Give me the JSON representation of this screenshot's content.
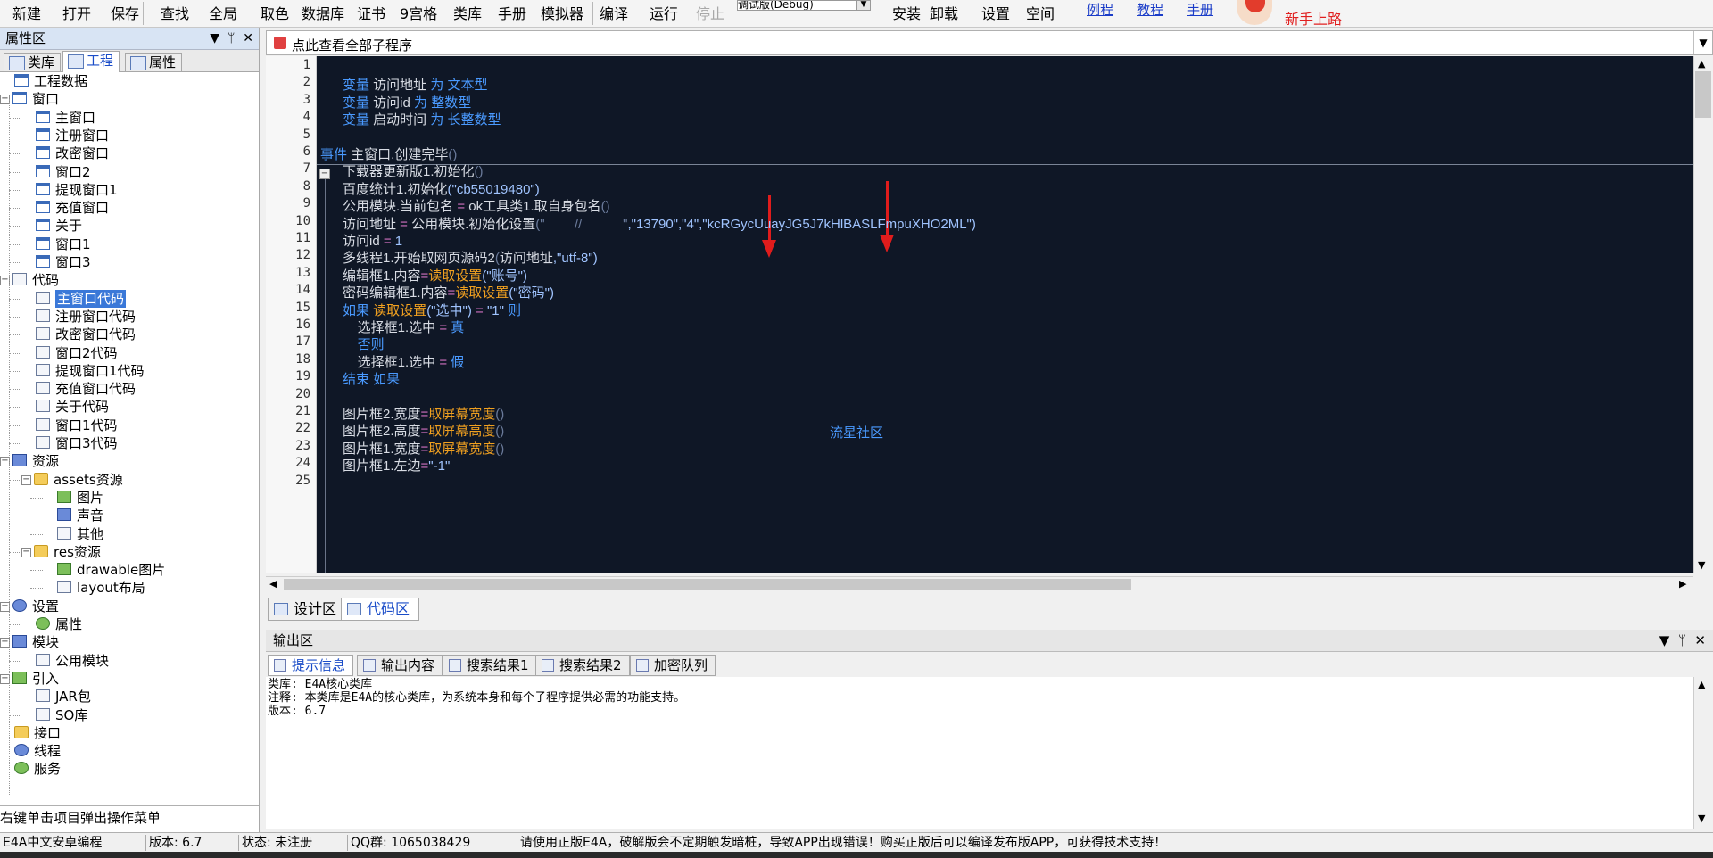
{
  "toolbar": {
    "items": [
      {
        "label": "新建",
        "icon": "new-icon"
      },
      {
        "label": "打开",
        "icon": "open-icon"
      },
      {
        "label": "保存",
        "icon": "save-icon"
      },
      {
        "label": "查找",
        "icon": "find-icon"
      },
      {
        "label": "全局",
        "icon": "global-icon"
      },
      {
        "label": "取色",
        "icon": "color-picker-icon"
      },
      {
        "label": "数据库",
        "icon": "database-icon"
      },
      {
        "label": "证书",
        "icon": "certificate-icon"
      },
      {
        "label": "9宫格",
        "icon": "grid-icon"
      },
      {
        "label": "类库",
        "icon": "library-icon"
      },
      {
        "label": "手册",
        "icon": "manual-icon"
      },
      {
        "label": "模拟器",
        "icon": "emulator-icon"
      },
      {
        "label": "编译",
        "icon": "compile-icon"
      },
      {
        "label": "运行",
        "icon": "run-icon"
      },
      {
        "label": "停止",
        "icon": "stop-icon"
      },
      {
        "label": "安装",
        "icon": "install-icon"
      },
      {
        "label": "卸载",
        "icon": "uninstall-icon"
      },
      {
        "label": "设置",
        "icon": "settings-icon"
      },
      {
        "label": "空间",
        "icon": "space-icon"
      }
    ],
    "mode": "调试版(Debug)",
    "links": [
      "例程",
      "教程",
      "手册"
    ],
    "newbie": "新手上路"
  },
  "left": {
    "title": "属性区",
    "tabs": [
      "类库",
      "工程",
      "属性"
    ],
    "hint": "右键单击项目弹出操作菜单",
    "tree": [
      {
        "label": "工程数据",
        "depth": 0,
        "icon": "project-icon",
        "exp": ""
      },
      {
        "label": "窗口",
        "depth": 0,
        "icon": "window-folder-icon",
        "exp": "-"
      },
      {
        "label": "主窗口",
        "depth": 1,
        "icon": "window-icon",
        "exp": ""
      },
      {
        "label": "注册窗口",
        "depth": 1,
        "icon": "window-icon",
        "exp": ""
      },
      {
        "label": "改密窗口",
        "depth": 1,
        "icon": "window-icon",
        "exp": ""
      },
      {
        "label": "窗口2",
        "depth": 1,
        "icon": "window-icon",
        "exp": ""
      },
      {
        "label": "提现窗口1",
        "depth": 1,
        "icon": "window-icon",
        "exp": ""
      },
      {
        "label": "充值窗口",
        "depth": 1,
        "icon": "window-icon",
        "exp": ""
      },
      {
        "label": "关于",
        "depth": 1,
        "icon": "window-icon",
        "exp": ""
      },
      {
        "label": "窗口1",
        "depth": 1,
        "icon": "window-icon",
        "exp": ""
      },
      {
        "label": "窗口3",
        "depth": 1,
        "icon": "window-icon",
        "exp": ""
      },
      {
        "label": "代码",
        "depth": 0,
        "icon": "code-folder-icon",
        "exp": "-"
      },
      {
        "label": "主窗口代码",
        "depth": 1,
        "icon": "code-file-icon",
        "exp": "",
        "selected": true
      },
      {
        "label": "注册窗口代码",
        "depth": 1,
        "icon": "code-file-icon",
        "exp": ""
      },
      {
        "label": "改密窗口代码",
        "depth": 1,
        "icon": "code-file-icon",
        "exp": ""
      },
      {
        "label": "窗口2代码",
        "depth": 1,
        "icon": "code-file-icon",
        "exp": ""
      },
      {
        "label": "提现窗口1代码",
        "depth": 1,
        "icon": "code-file-icon",
        "exp": ""
      },
      {
        "label": "充值窗口代码",
        "depth": 1,
        "icon": "code-file-icon",
        "exp": ""
      },
      {
        "label": "关于代码",
        "depth": 1,
        "icon": "code-file-icon",
        "exp": ""
      },
      {
        "label": "窗口1代码",
        "depth": 1,
        "icon": "code-file-icon",
        "exp": ""
      },
      {
        "label": "窗口3代码",
        "depth": 1,
        "icon": "code-file-icon",
        "exp": ""
      },
      {
        "label": "资源",
        "depth": 0,
        "icon": "resource-icon",
        "exp": "-"
      },
      {
        "label": "assets资源",
        "depth": 1,
        "icon": "folder-icon",
        "exp": "-"
      },
      {
        "label": "图片",
        "depth": 2,
        "icon": "image-icon",
        "exp": ""
      },
      {
        "label": "声音",
        "depth": 2,
        "icon": "music-icon",
        "exp": ""
      },
      {
        "label": "其他",
        "depth": 2,
        "icon": "question-icon",
        "exp": ""
      },
      {
        "label": "res资源",
        "depth": 1,
        "icon": "folder-icon",
        "exp": "-"
      },
      {
        "label": "drawable图片",
        "depth": 2,
        "icon": "image-icon",
        "exp": ""
      },
      {
        "label": "layout布局",
        "depth": 2,
        "icon": "layout-icon",
        "exp": ""
      },
      {
        "label": "设置",
        "depth": 0,
        "icon": "info-icon",
        "exp": "-"
      },
      {
        "label": "属性",
        "depth": 1,
        "icon": "gear-icon",
        "exp": ""
      },
      {
        "label": "模块",
        "depth": 0,
        "icon": "module-icon",
        "exp": "-"
      },
      {
        "label": "公用模块",
        "depth": 1,
        "icon": "module-file-icon",
        "exp": ""
      },
      {
        "label": "引入",
        "depth": 0,
        "icon": "import-icon",
        "exp": "-"
      },
      {
        "label": "JAR包",
        "depth": 1,
        "icon": "jar-icon",
        "exp": ""
      },
      {
        "label": "SO库",
        "depth": 1,
        "icon": "so-icon",
        "exp": ""
      },
      {
        "label": "接口",
        "depth": 0,
        "icon": "interface-icon",
        "exp": ""
      },
      {
        "label": "线程",
        "depth": 0,
        "icon": "thread-icon",
        "exp": ""
      },
      {
        "label": "服务",
        "depth": 0,
        "icon": "service-icon",
        "exp": ""
      }
    ]
  },
  "editor": {
    "subroutine_bar": "点此查看全部子程序",
    "lines": [
      {
        "n": "1",
        "segs": []
      },
      {
        "n": "2",
        "segs": [
          [
            "kw",
            "变量 "
          ],
          [
            "",
            "访问地址 "
          ],
          [
            "kw",
            "为 "
          ],
          [
            "tp",
            "文本型"
          ]
        ]
      },
      {
        "n": "3",
        "segs": [
          [
            "kw",
            "变量 "
          ],
          [
            "",
            "访问id "
          ],
          [
            "kw",
            "为 "
          ],
          [
            "tp",
            "整数型"
          ]
        ]
      },
      {
        "n": "4",
        "segs": [
          [
            "kw",
            "变量 "
          ],
          [
            "",
            "启动时间 "
          ],
          [
            "kw",
            "为 "
          ],
          [
            "tp",
            "长整数型"
          ]
        ]
      },
      {
        "n": "5",
        "segs": []
      },
      {
        "n": "6",
        "segs": [
          [
            "kw",
            "事件 "
          ],
          [
            "",
            "主窗口.创建完毕"
          ],
          [
            "dim",
            "()"
          ]
        ]
      },
      {
        "n": "7",
        "segs": [
          [
            "",
            "下载器更新版1.初始化"
          ],
          [
            "dim",
            "()"
          ]
        ]
      },
      {
        "n": "8",
        "segs": [
          [
            "",
            "百度统计1.初始化"
          ],
          [
            "st",
            "(\"cb55019480\")"
          ]
        ]
      },
      {
        "n": "9",
        "segs": [
          [
            "",
            "公用模块.当前包名 "
          ],
          [
            "op",
            "= "
          ],
          [
            "",
            "ok工具类1.取自身包名"
          ],
          [
            "dim",
            "()"
          ]
        ]
      },
      {
        "n": "10",
        "segs": [
          [
            "",
            "访问地址 "
          ],
          [
            "op",
            "= "
          ],
          [
            "",
            "公用模块.初始化设置"
          ],
          [
            "dim",
            "(\"        //           \""
          ],
          [
            "st",
            ",\"13790\",\"4\",\"kcRGycUuayJG5J7kHlBASLFmpuXHO2ML\")"
          ]
        ]
      },
      {
        "n": "11",
        "segs": [
          [
            "",
            "访问id "
          ],
          [
            "op",
            "= "
          ],
          [
            "lit",
            "1"
          ]
        ]
      },
      {
        "n": "12",
        "segs": [
          [
            "",
            "多线程1.开始取网页源码2"
          ],
          [
            "dim",
            "("
          ],
          [
            "",
            "访问地址"
          ],
          [
            "st",
            ",\"utf-8\")"
          ]
        ]
      },
      {
        "n": "13",
        "segs": [
          [
            "",
            "编辑框1.内容"
          ],
          [
            "op",
            "="
          ],
          [
            "fn",
            "读取设置"
          ],
          [
            "st",
            "(\"账号\")"
          ]
        ]
      },
      {
        "n": "14",
        "segs": [
          [
            "",
            "密码编辑框1.内容"
          ],
          [
            "op",
            "="
          ],
          [
            "fn",
            "读取设置"
          ],
          [
            "st",
            "(\"密码\")"
          ]
        ]
      },
      {
        "n": "15",
        "segs": [
          [
            "kw",
            "如果 "
          ],
          [
            "fn",
            "读取设置"
          ],
          [
            "st",
            "(\"选中\") "
          ],
          [
            "op",
            "= "
          ],
          [
            "st",
            "\"1\" "
          ],
          [
            "kw",
            "则"
          ]
        ]
      },
      {
        "n": "16",
        "segs": [
          [
            "",
            "    选择框1.选中 "
          ],
          [
            "op",
            "= "
          ],
          [
            "kw",
            "真"
          ]
        ]
      },
      {
        "n": "17",
        "segs": [
          [
            "kw",
            "    否则"
          ]
        ]
      },
      {
        "n": "18",
        "segs": [
          [
            "",
            "    选择框1.选中 "
          ],
          [
            "op",
            "= "
          ],
          [
            "kw",
            "假"
          ]
        ]
      },
      {
        "n": "19",
        "segs": [
          [
            "kw",
            "结束 如果"
          ]
        ]
      },
      {
        "n": "20",
        "segs": []
      },
      {
        "n": "21",
        "segs": [
          [
            "",
            "图片框2.宽度"
          ],
          [
            "op",
            "="
          ],
          [
            "fn",
            "取屏幕宽度"
          ],
          [
            "dim",
            "()"
          ]
        ]
      },
      {
        "n": "22",
        "segs": [
          [
            "",
            "图片框2.高度"
          ],
          [
            "op",
            "="
          ],
          [
            "fn",
            "取屏幕高度"
          ],
          [
            "dim",
            "()"
          ]
        ]
      },
      {
        "n": "23",
        "segs": [
          [
            "",
            "图片框1.宽度"
          ],
          [
            "op",
            "="
          ],
          [
            "fn",
            "取屏幕宽度"
          ],
          [
            "dim",
            "()"
          ]
        ]
      },
      {
        "n": "24",
        "segs": [
          [
            "",
            "图片框1.左边"
          ],
          [
            "op",
            "="
          ],
          [
            "st",
            "\"-1\""
          ]
        ]
      },
      {
        "n": "25",
        "segs": []
      }
    ],
    "watermark": "流星社区",
    "bottom_tabs": [
      "设计区",
      "代码区"
    ]
  },
  "output": {
    "title": "输出区",
    "tabs": [
      "提示信息",
      "输出内容",
      "搜索结果1",
      "搜索结果2",
      "加密队列"
    ],
    "lines": [
      "类库: E4A核心类库",
      "注释: 本类库是E4A的核心类库，为系统本身和每个子程序提供必需的功能支持。",
      "版本: 6.7"
    ]
  },
  "status": {
    "app": "E4A中文安卓编程",
    "version": "版本: 6.7",
    "state": "状态: 未注册",
    "qq": "QQ群: 1065038429",
    "notice": "请使用正版E4A，破解版会不定期触发暗桩，导致APP出现错误！购买正版后可以编译发布版APP，可获得技术支持！"
  },
  "colors": {
    "editor_bg": "#0f1726",
    "keyword": "#4a9aff",
    "function": "#f0a020",
    "annotation_arrow": "#e01c1c",
    "selection": "#3a78d8"
  }
}
